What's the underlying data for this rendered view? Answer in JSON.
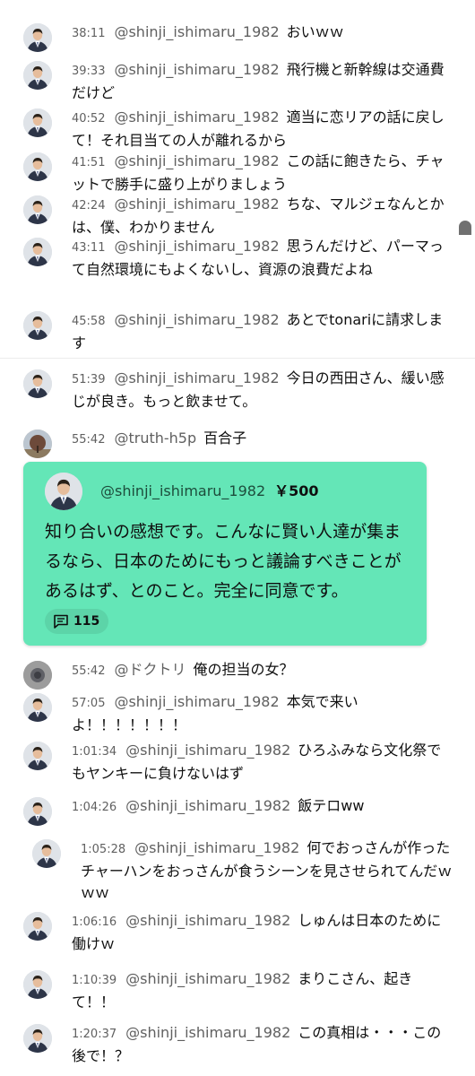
{
  "messages": [
    {
      "time": "38:11",
      "author": "@shinji_ishimaru_1982",
      "text": "おいｗｗ",
      "avatar": "suit-man"
    },
    {
      "time": "39:33",
      "author": "@shinji_ishimaru_1982",
      "text": "飛行機と新幹線は交通費だけど",
      "avatar": "suit-man"
    },
    {
      "time": "40:52",
      "author": "@shinji_ishimaru_1982",
      "text": "適当に恋リアの話に戻して！それ目当ての人が離れるから",
      "avatar": "suit-man"
    },
    {
      "time": "41:51",
      "author": "@shinji_ishimaru_1982",
      "text": "この話に飽きたら、チャットで勝手に盛り上がりましょう",
      "avatar": "suit-man"
    },
    {
      "time": "42:24",
      "author": "@shinji_ishimaru_1982",
      "text": "ちな、マルジェなんとかは、僕、わかりません",
      "avatar": "suit-man"
    },
    {
      "time": "43:11",
      "author": "@shinji_ishimaru_1982",
      "text": "思うんだけど、パーマって自然環境にもよくないし、資源の浪費だよね",
      "avatar": "suit-man"
    },
    {
      "time": "45:58",
      "author": "@shinji_ishimaru_1982",
      "text": "あとでtonariに請求します",
      "avatar": "suit-man"
    },
    {
      "time": "51:39",
      "author": "@shinji_ishimaru_1982",
      "text": "今日の西田さん、緩い感じが良き。もっと飲ませて。",
      "avatar": "suit-man"
    },
    {
      "time": "55:42",
      "author": "@truth-h5p",
      "text": "百合子",
      "avatar": "tree-landscape"
    },
    {
      "time": "55:42",
      "author": "@ドクトリ",
      "text": "俺の担当の女？",
      "avatar": "gray-blur"
    },
    {
      "time": "57:05",
      "author": "@shinji_ishimaru_1982",
      "text": "本気で来いよ！！！！！！！",
      "avatar": "suit-man"
    },
    {
      "time": "1:01:34",
      "author": "@shinji_ishimaru_1982",
      "text": "ひろふみなら文化祭でもヤンキーに負けないはず",
      "avatar": "suit-man"
    },
    {
      "time": "1:04:26",
      "author": "@shinji_ishimaru_1982",
      "text": "飯テロww",
      "avatar": "suit-man"
    },
    {
      "time": "1:05:28",
      "author": "@shinji_ishimaru_1982",
      "text": "何でおっさんが作ったチャーハンをおっさんが食うシーンを見させられてんだｗｗｗ",
      "avatar": "suit-man"
    },
    {
      "time": "1:06:16",
      "author": "@shinji_ishimaru_1982",
      "text": "しゅんは日本のために働けｗ",
      "avatar": "suit-man"
    },
    {
      "time": "1:10:39",
      "author": "@shinji_ishimaru_1982",
      "text": "まりこさん、起きて！！",
      "avatar": "suit-man"
    },
    {
      "time": "1:20:37",
      "author": "@shinji_ishimaru_1982",
      "text": "この真相は・・・この後で！？",
      "avatar": "suit-man"
    }
  ],
  "superchat": {
    "author": "@shinji_ishimaru_1982",
    "amount": "￥500",
    "text": "知り合いの感想です。こんなに賢い人達が集まるなら、日本のためにもっと議論すべきことがあるはず、とのこと。完全に同意です。",
    "reply_count": "115",
    "reply_icon": "comment-icon",
    "color": "#64e6b7",
    "avatar": "suit-man"
  }
}
